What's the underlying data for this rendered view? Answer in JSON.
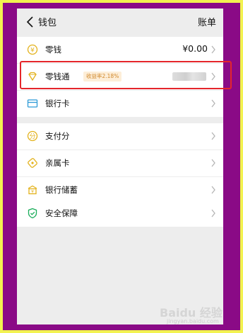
{
  "header": {
    "title": "钱包",
    "bill_label": "账单"
  },
  "group1": [
    {
      "icon": "yuan-coin-icon",
      "label": "零钱",
      "value": "¥0.00"
    },
    {
      "icon": "diamond-icon",
      "label": "零钱通",
      "badge": "收益率2.18%"
    },
    {
      "icon": "bank-card-icon",
      "label": "银行卡"
    }
  ],
  "group2": [
    {
      "icon": "score-badge-icon",
      "label": "支付分"
    },
    {
      "icon": "family-card-icon",
      "label": "亲属卡"
    },
    {
      "icon": "bank-savings-icon",
      "label": "银行储蓄"
    }
  ],
  "group3": [
    {
      "icon": "shield-check-icon",
      "label": "安全保障"
    }
  ],
  "watermark": {
    "text": "Baidu 经验",
    "url": "jingyan.baidu.com"
  },
  "colors": {
    "accent_green": "#1aad5a",
    "highlight_red": "#e5262b",
    "gold": "#e3b21c"
  }
}
